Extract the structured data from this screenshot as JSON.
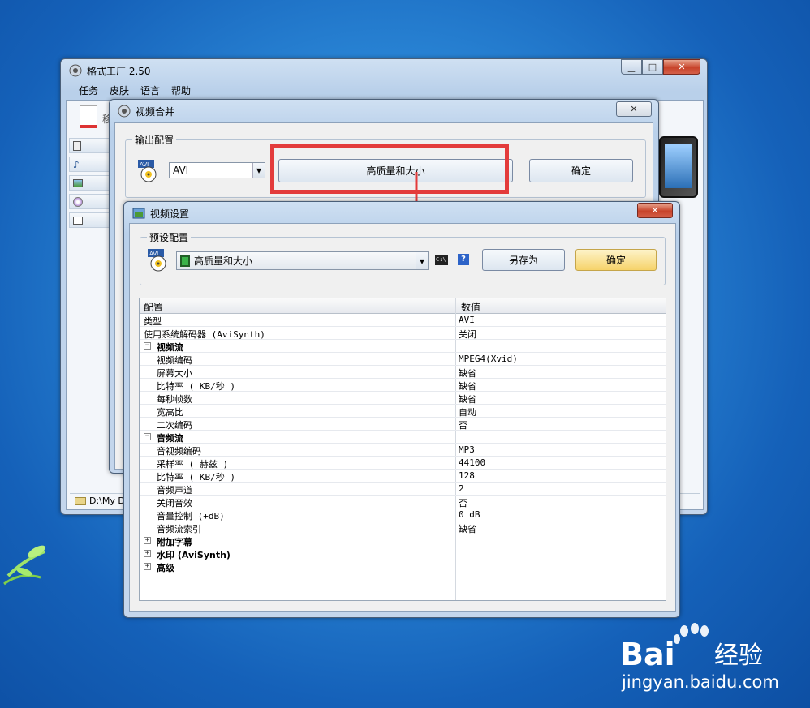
{
  "main_window": {
    "title": "格式工厂 2.50",
    "menu": [
      "任务",
      "皮肤",
      "语言",
      "帮助"
    ],
    "status_path": "D:\\My Do",
    "toolbar_fragment": "移"
  },
  "merge_window": {
    "title": "视频合并",
    "output_group_label": "输出配置",
    "format_value": "AVI",
    "preset_button": "高质量和大小",
    "ok_button": "确定"
  },
  "settings_window": {
    "title": "视频设置",
    "preset_group_label": "预设配置",
    "preset_value": "高质量和大小",
    "cmd_icon_text": "C:\\",
    "help_icon_text": "?",
    "save_as_button": "另存为",
    "ok_button": "确定",
    "grid": {
      "headers": [
        "配置",
        "数值"
      ],
      "rows": [
        {
          "key": "类型",
          "value": "AVI"
        },
        {
          "key": "使用系统解码器 (AviSynth)",
          "value": "关闭"
        },
        {
          "key": "视频流",
          "value": "",
          "category": true,
          "expander": "⊟"
        },
        {
          "key": "视频编码",
          "value": "MPEG4(Xvid)"
        },
        {
          "key": "屏幕大小",
          "value": "缺省"
        },
        {
          "key": "比特率 ( KB/秒 )",
          "value": "缺省"
        },
        {
          "key": "每秒帧数",
          "value": "缺省"
        },
        {
          "key": "宽高比",
          "value": "自动"
        },
        {
          "key": "二次编码",
          "value": "否"
        },
        {
          "key": "音频流",
          "value": "",
          "category": true,
          "expander": "⊟"
        },
        {
          "key": "音视频编码",
          "value": "MP3"
        },
        {
          "key": "采样率 ( 赫兹 )",
          "value": "44100"
        },
        {
          "key": "比特率 ( KB/秒 )",
          "value": "128"
        },
        {
          "key": "音频声道",
          "value": "2"
        },
        {
          "key": "关闭音效",
          "value": "否"
        },
        {
          "key": "音量控制 (+dB)",
          "value": "0 dB"
        },
        {
          "key": "音频流索引",
          "value": "缺省"
        },
        {
          "key": "附加字幕",
          "value": "",
          "category": true,
          "expander": "⊞"
        },
        {
          "key": "水印 (AviSynth)",
          "value": "",
          "category": true,
          "expander": "⊞"
        },
        {
          "key": "高级",
          "value": "",
          "category": true,
          "expander": "⊞"
        }
      ]
    }
  },
  "watermark": {
    "brand_a": "Bai",
    "brand_b": "经验",
    "url": "jingyan.baidu.com"
  },
  "colors": {
    "highlight_red": "#e33b3b",
    "desktop_blue": "#2a86d6",
    "ok_yellow": "#f6d36a"
  }
}
